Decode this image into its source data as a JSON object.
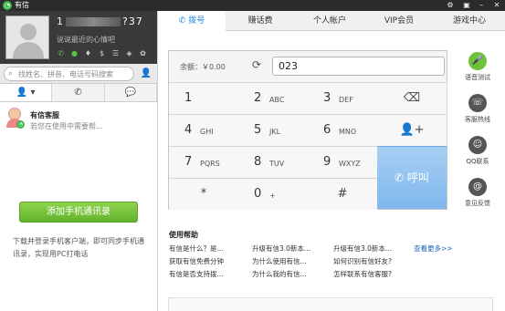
{
  "titlebar": {
    "app_title": "有信",
    "icons": [
      "gear-icon",
      "minimize-icon",
      "close-icon"
    ]
  },
  "profile": {
    "phone_prefix": "1",
    "phone_suffix": "?37",
    "signature": "说说最近的心情吧"
  },
  "search": {
    "placeholder": "找姓名、拼音、电话号码搜索"
  },
  "contact": {
    "name": "有信客服",
    "status": "若您在使用中需要帮..."
  },
  "left": {
    "add_button": "添加手机通讯录",
    "tip": "下载并登录手机客户端，即可同步手机通讯录，实现用PC打电话"
  },
  "nav": {
    "tabs": [
      "拨号",
      "赚话费",
      "个人帐户",
      "VIP会员",
      "游戏中心"
    ]
  },
  "dialer": {
    "balance": "余额：￥0.00",
    "input_value": "023",
    "keys": [
      {
        "d": "1",
        "l": ""
      },
      {
        "d": "2",
        "l": "ABC"
      },
      {
        "d": "3",
        "l": "DEF"
      },
      {
        "d": "4",
        "l": "GHI"
      },
      {
        "d": "5",
        "l": "JKL"
      },
      {
        "d": "6",
        "l": "MNO"
      },
      {
        "d": "7",
        "l": "PQRS"
      },
      {
        "d": "8",
        "l": "TUV"
      },
      {
        "d": "9",
        "l": "WXYZ"
      },
      {
        "d": "*",
        "l": ""
      },
      {
        "d": "0",
        "l": "+"
      },
      {
        "d": "#",
        "l": ""
      }
    ],
    "call_label": "呼叫"
  },
  "side": [
    {
      "label": "语音测试",
      "icon": "microphone-icon"
    },
    {
      "label": "客服热线",
      "icon": "hotline-icon"
    },
    {
      "label": "QQ联系",
      "icon": "qq-icon"
    },
    {
      "label": "意见反馈",
      "icon": "feedback-icon"
    }
  ],
  "help": {
    "title": "使用帮助",
    "links": [
      "有信是什么？是...",
      "升级有信3.0新本...",
      "升级有信3.0新本...",
      "获取有信免费分钟",
      "为什么使用有信...",
      "如何识别有信好友?",
      "有信是否支持拨...",
      "为什么我的有信...",
      "怎样联系有信客服?"
    ],
    "more": "查看更多>>"
  }
}
